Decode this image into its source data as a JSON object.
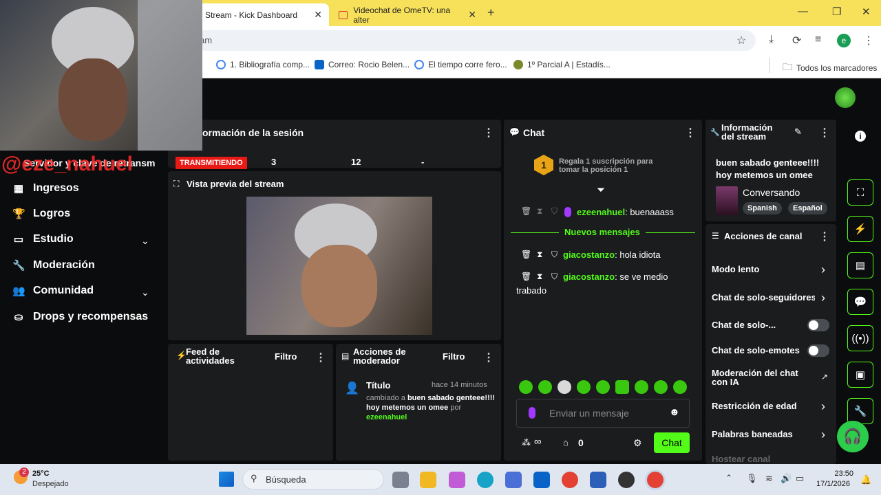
{
  "browser": {
    "tabs": [
      {
        "label": "Stream - Kick Dashboard"
      },
      {
        "label": "Videochat de OmeTV: una alter"
      }
    ],
    "url": "am",
    "profile_initial": "e",
    "bookmarks": [
      {
        "label": "1. Bibliografía comp..."
      },
      {
        "label": "Correo: Rocio Belen..."
      },
      {
        "label": "El tiempo corre fero..."
      },
      {
        "label": "1º Parcial A | Estadís..."
      }
    ],
    "all_bookmarks": "Todos los marcadores"
  },
  "overlay": {
    "handle": "@eze_nahuel"
  },
  "sidebar": {
    "partial_item": "Servidor y clave de retransm",
    "items": [
      {
        "label": "Ingresos"
      },
      {
        "label": "Logros"
      },
      {
        "label": "Estudio"
      },
      {
        "label": "Moderación"
      },
      {
        "label": "Comunidad"
      },
      {
        "label": "Drops y recompensas"
      }
    ]
  },
  "session": {
    "title": "ormación de la sesión",
    "status": "TRANSMITIENDO",
    "stat1": "3",
    "stat2": "12",
    "stat3": "-"
  },
  "preview": {
    "title": "Vista previa del stream"
  },
  "feed": {
    "title": "Feed de actividades",
    "filter": "Filtro"
  },
  "modactions": {
    "title": "Acciones de moderador",
    "filter": "Filtro",
    "item_title": "Título",
    "item_time": "hace 14 minutos",
    "item_changed": "cambiado a",
    "item_value": "buen sabado genteee!!!! hoy metemos un omee",
    "item_by": "por",
    "item_user": "ezeenahuel"
  },
  "chat": {
    "title": "Chat",
    "gift_text": "Regala 1 suscripción para tomar la posición 1",
    "gift_rank": "1",
    "new_messages": "Nuevos mensajes",
    "messages": [
      {
        "user": "ezeenahuel",
        "text": ": buenaaass"
      },
      {
        "user": "giacostanzo",
        "text": ": hola idiota"
      },
      {
        "user": "giacostanzo",
        "text": ": se ve medio"
      }
    ],
    "wrap_text": "trabado",
    "input_placeholder": "Enviar un mensaje",
    "infinity": "∞",
    "count": "0",
    "send_label": "Chat"
  },
  "streaminfo": {
    "title": "Información del stream",
    "stream_title": "buen sabado genteee!!!! hoy metemos un omee",
    "category": "Conversando",
    "tags": [
      "Spanish",
      "Español"
    ]
  },
  "channel": {
    "title": "Acciones de canal",
    "slow": "Modo lento",
    "followers": "Chat de solo-seguidores",
    "subs": "Chat de solo-...",
    "emotes": "Chat de solo-emotes",
    "ai": "Moderación del chat con IA",
    "age": "Restricción de edad",
    "banned": "Palabras baneadas",
    "host": "Hostear canal"
  },
  "taskbar": {
    "temp": "25°C",
    "weather": "Despejado",
    "weather_badge": "2",
    "search": "Búsqueda",
    "time": "23:50",
    "date": "17/1/2026"
  },
  "colors": {
    "accent": "#53fc18",
    "live": "#e91916",
    "tabbar": "#f7e15a"
  }
}
